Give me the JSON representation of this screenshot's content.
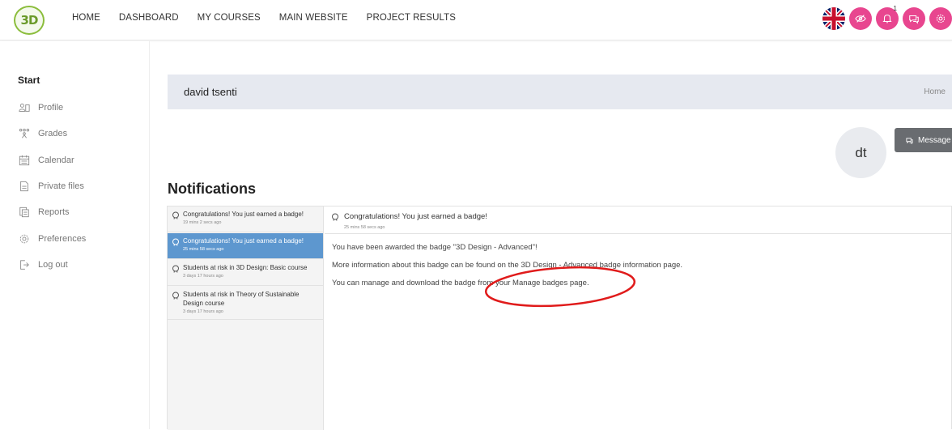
{
  "brand": {
    "logo_text": "3D",
    "accent_color": "#e8468f",
    "active_color": "#5d97cf"
  },
  "nav": {
    "items": [
      "HOME",
      "DASHBOARD",
      "MY COURSES",
      "MAIN WEBSITE",
      "PROJECT RESULTS"
    ],
    "icons": [
      "uk-flag-icon",
      "visibility-icon",
      "notifications-icon",
      "messages-icon",
      "settings-icon"
    ],
    "notification_count": "1"
  },
  "sidebar": {
    "title": "Start",
    "items": [
      {
        "label": "Profile",
        "icon": "profile-icon"
      },
      {
        "label": "Grades",
        "icon": "grades-icon"
      },
      {
        "label": "Calendar",
        "icon": "calendar-icon"
      },
      {
        "label": "Private files",
        "icon": "private-files-icon"
      },
      {
        "label": "Reports",
        "icon": "reports-icon"
      },
      {
        "label": "Preferences",
        "icon": "preferences-icon"
      },
      {
        "label": "Log out",
        "icon": "logout-icon"
      }
    ]
  },
  "header": {
    "name": "david tsenti",
    "breadcrumb": "Home"
  },
  "profile": {
    "avatar_initials": "dt",
    "message_button": "Message"
  },
  "page_title": "Notifications",
  "notifications": [
    {
      "title": "Congratulations! You just earned a badge!",
      "time": "19 mins 2 secs ago"
    },
    {
      "title": "Congratulations! You just earned a badge!",
      "time": "25 mins 58 secs ago"
    },
    {
      "title": "Students at risk in 3D Design: Basic course",
      "time": "3 days 17 hours ago"
    },
    {
      "title": "Students at risk in Theory of Sustainable Design course",
      "time": "3 days 17 hours ago"
    }
  ],
  "detail": {
    "title": "Congratulations! You just earned a badge!",
    "time": "25 mins 58 secs ago",
    "lines": [
      "You have been awarded the badge \"3D Design - Advanced\"!",
      "More information about this badge can be found on the 3D Design - Advanced badge information page.",
      "You can manage and download the badge from your Manage badges page."
    ]
  }
}
